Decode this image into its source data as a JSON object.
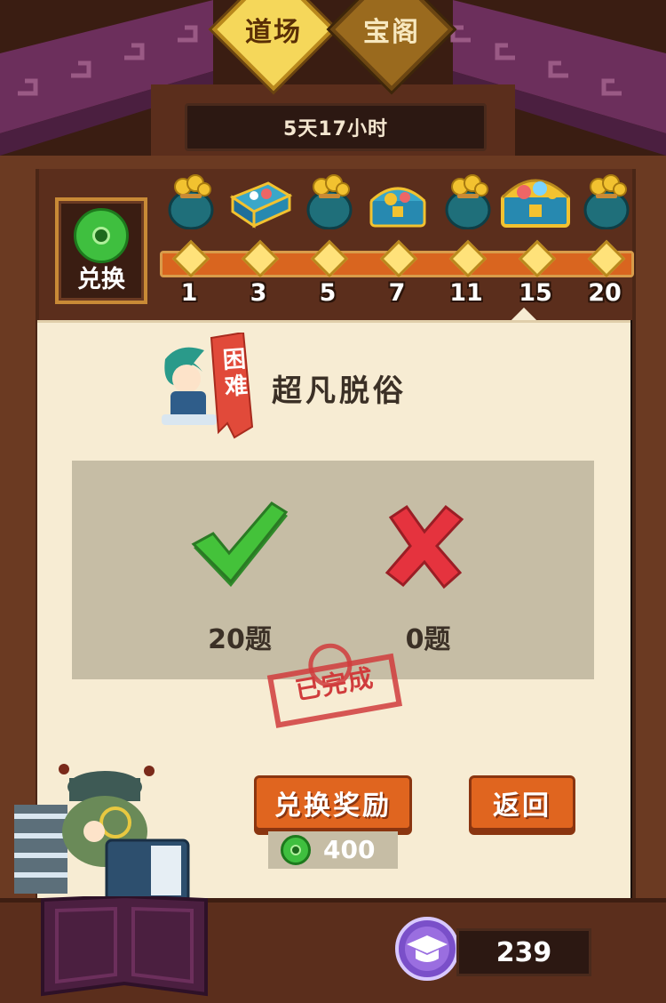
{
  "tabs": [
    {
      "label": "道场",
      "active": true
    },
    {
      "label": "宝阁",
      "active": false
    }
  ],
  "timer": "5天17小时",
  "exchange": {
    "label": "兑换",
    "icon": "jade-coin-icon"
  },
  "milestones": [
    {
      "value": "1",
      "reward": "coin-bag-icon"
    },
    {
      "value": "3",
      "reward": "gift-box-icon"
    },
    {
      "value": "5",
      "reward": "coin-bag-icon"
    },
    {
      "value": "7",
      "reward": "treasure-chest-icon"
    },
    {
      "value": "11",
      "reward": "coin-bag-icon"
    },
    {
      "value": "15",
      "reward": "gold-chest-icon"
    },
    {
      "value": "20",
      "reward": "coin-bag-icon"
    }
  ],
  "level": {
    "difficulty": "困难",
    "title": "超凡脱俗"
  },
  "result": {
    "correct": "20题",
    "wrong": "0题",
    "stamp": "已完成"
  },
  "buttons": {
    "redeem": "兑换奖励",
    "back": "返回"
  },
  "cost": {
    "value": "400",
    "icon": "jade-coin-icon"
  },
  "score": {
    "value": "239",
    "icon": "graduation-cap-icon"
  },
  "colors": {
    "accent": "#e0651f",
    "parchment": "#f7ecd3",
    "panel": "#c6bda5",
    "correct": "#44c23a",
    "wrong": "#e5333e"
  }
}
